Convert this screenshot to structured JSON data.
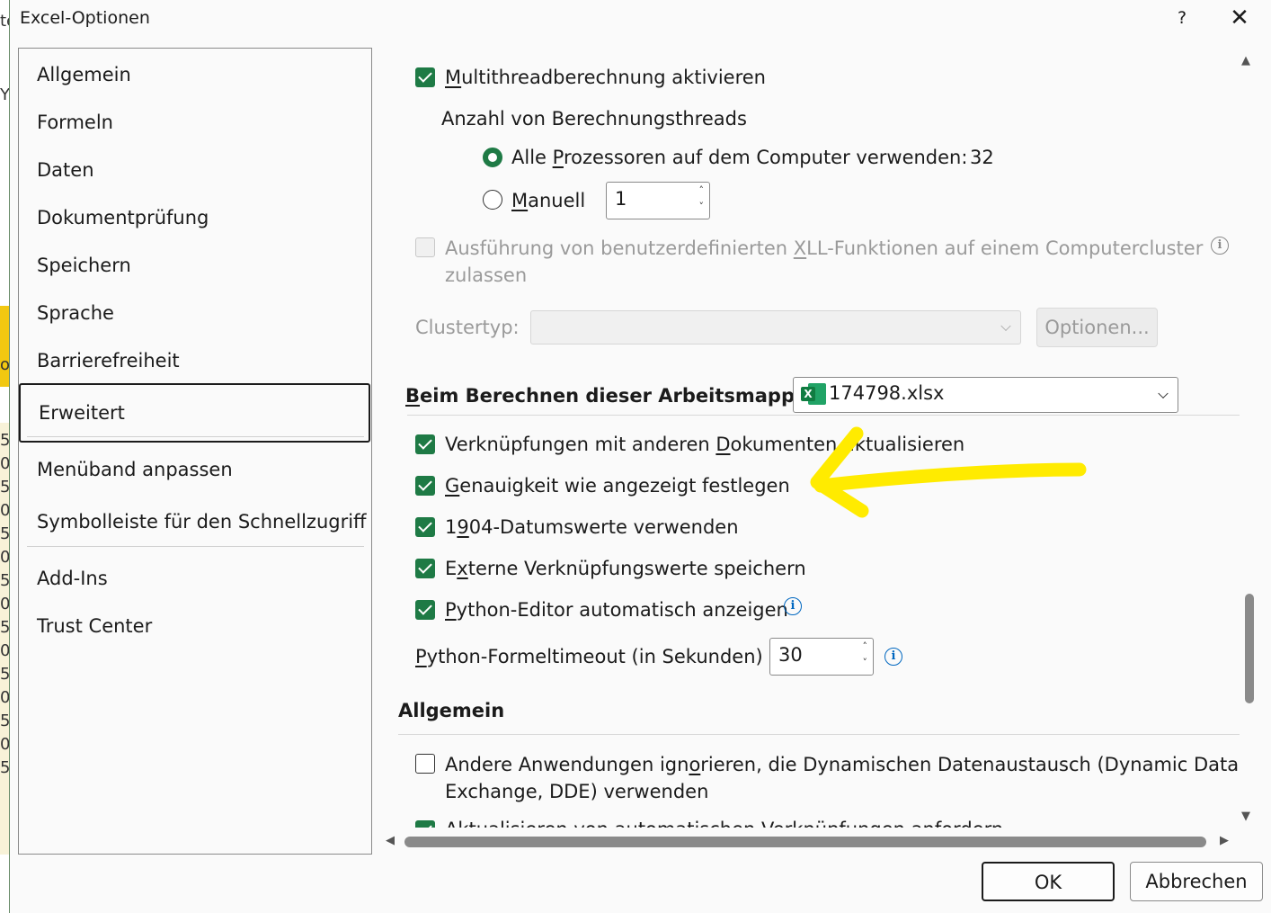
{
  "window": {
    "title": "Excel-Optionen",
    "help_label": "?",
    "close_label": "✕"
  },
  "background": {
    "cells": [
      "te",
      "Y",
      "o",
      "5",
      "0",
      "5",
      "0",
      "5",
      "0",
      "5",
      "0",
      "5",
      "0",
      "5",
      "0",
      "5",
      "0",
      "5"
    ]
  },
  "sidebar": {
    "items": [
      {
        "label": "Allgemein"
      },
      {
        "label": "Formeln"
      },
      {
        "label": "Daten"
      },
      {
        "label": "Dokumentprüfung"
      },
      {
        "label": "Speichern"
      },
      {
        "label": "Sprache"
      },
      {
        "label": "Barrierefreiheit"
      },
      {
        "label": "Erweitert",
        "selected": true
      },
      {
        "label": "Menüband anpassen"
      },
      {
        "label": "Symbolleiste für den Schnellzugriff"
      },
      {
        "label": "Add-Ins"
      },
      {
        "label": "Trust Center"
      }
    ]
  },
  "formulas": {
    "multithread": {
      "pre": "",
      "u": "M",
      "post": "ultithreadberechnung aktivieren",
      "checked": true
    },
    "threads_heading": "Anzahl von Berechnungsthreads",
    "all_processors": {
      "pre": "Alle ",
      "u": "P",
      "post": "rozessoren auf dem Computer verwenden:",
      "count": "32",
      "selected": true
    },
    "manual": {
      "pre": "",
      "u": "M",
      "post": "anuell",
      "value": "1",
      "selected": false
    },
    "xll_cluster": {
      "line1_pre": "Ausführung von benutzerdefinierten ",
      "line1_u": "X",
      "line1_post": "LL-Funktionen auf einem Computercluster",
      "line2": "zulassen",
      "checked": false,
      "disabled": true
    },
    "cluster_type_label": "Clustertyp:",
    "cluster_options_button": "Optionen..."
  },
  "workbook_section": {
    "label_u": "B",
    "label_post": "eim Berechnen dieser Arbeitsmappe:",
    "selected_workbook": "174798.xlsx",
    "icon": "excel-file-icon",
    "options": [
      {
        "pre": "Verknüpfungen mit anderen ",
        "u": "D",
        "post": "okumenten aktualisieren",
        "checked": true
      },
      {
        "pre": "",
        "u": "G",
        "post": "enauigkeit wie angezeigt festlegen",
        "checked": true
      },
      {
        "pre": "1",
        "u": "9",
        "post": "04-Datumswerte verwenden",
        "checked": true
      },
      {
        "pre": "E",
        "u": "x",
        "post": "terne Verknüpfungswerte speichern",
        "checked": true
      },
      {
        "pre": "",
        "u": "P",
        "post": "ython-Editor automatisch anzeigen",
        "checked": true
      }
    ],
    "python_timeout": {
      "pre": "",
      "u": "P",
      "post": "ython-Formeltimeout (in Sekunden)",
      "value": "30"
    }
  },
  "general_section": {
    "title": "Allgemein",
    "dde": {
      "line1_pre": "Andere Anwendungen ign",
      "line1_u": "o",
      "line1_post": "rieren, die Dynamischen Datenaustausch (Dynamic Data",
      "line2": "Exchange, DDE) verwenden",
      "checked": false
    },
    "update_links": {
      "label": "Aktualisieren von automatischen Verknüpfungen anfordern",
      "checked": true
    }
  },
  "annotation": {
    "color": "#ffeb00"
  },
  "footer": {
    "ok_label": "OK",
    "cancel_label": "Abbrechen"
  },
  "colors": {
    "accent": "#1e7a45",
    "info": "#0067c0"
  }
}
